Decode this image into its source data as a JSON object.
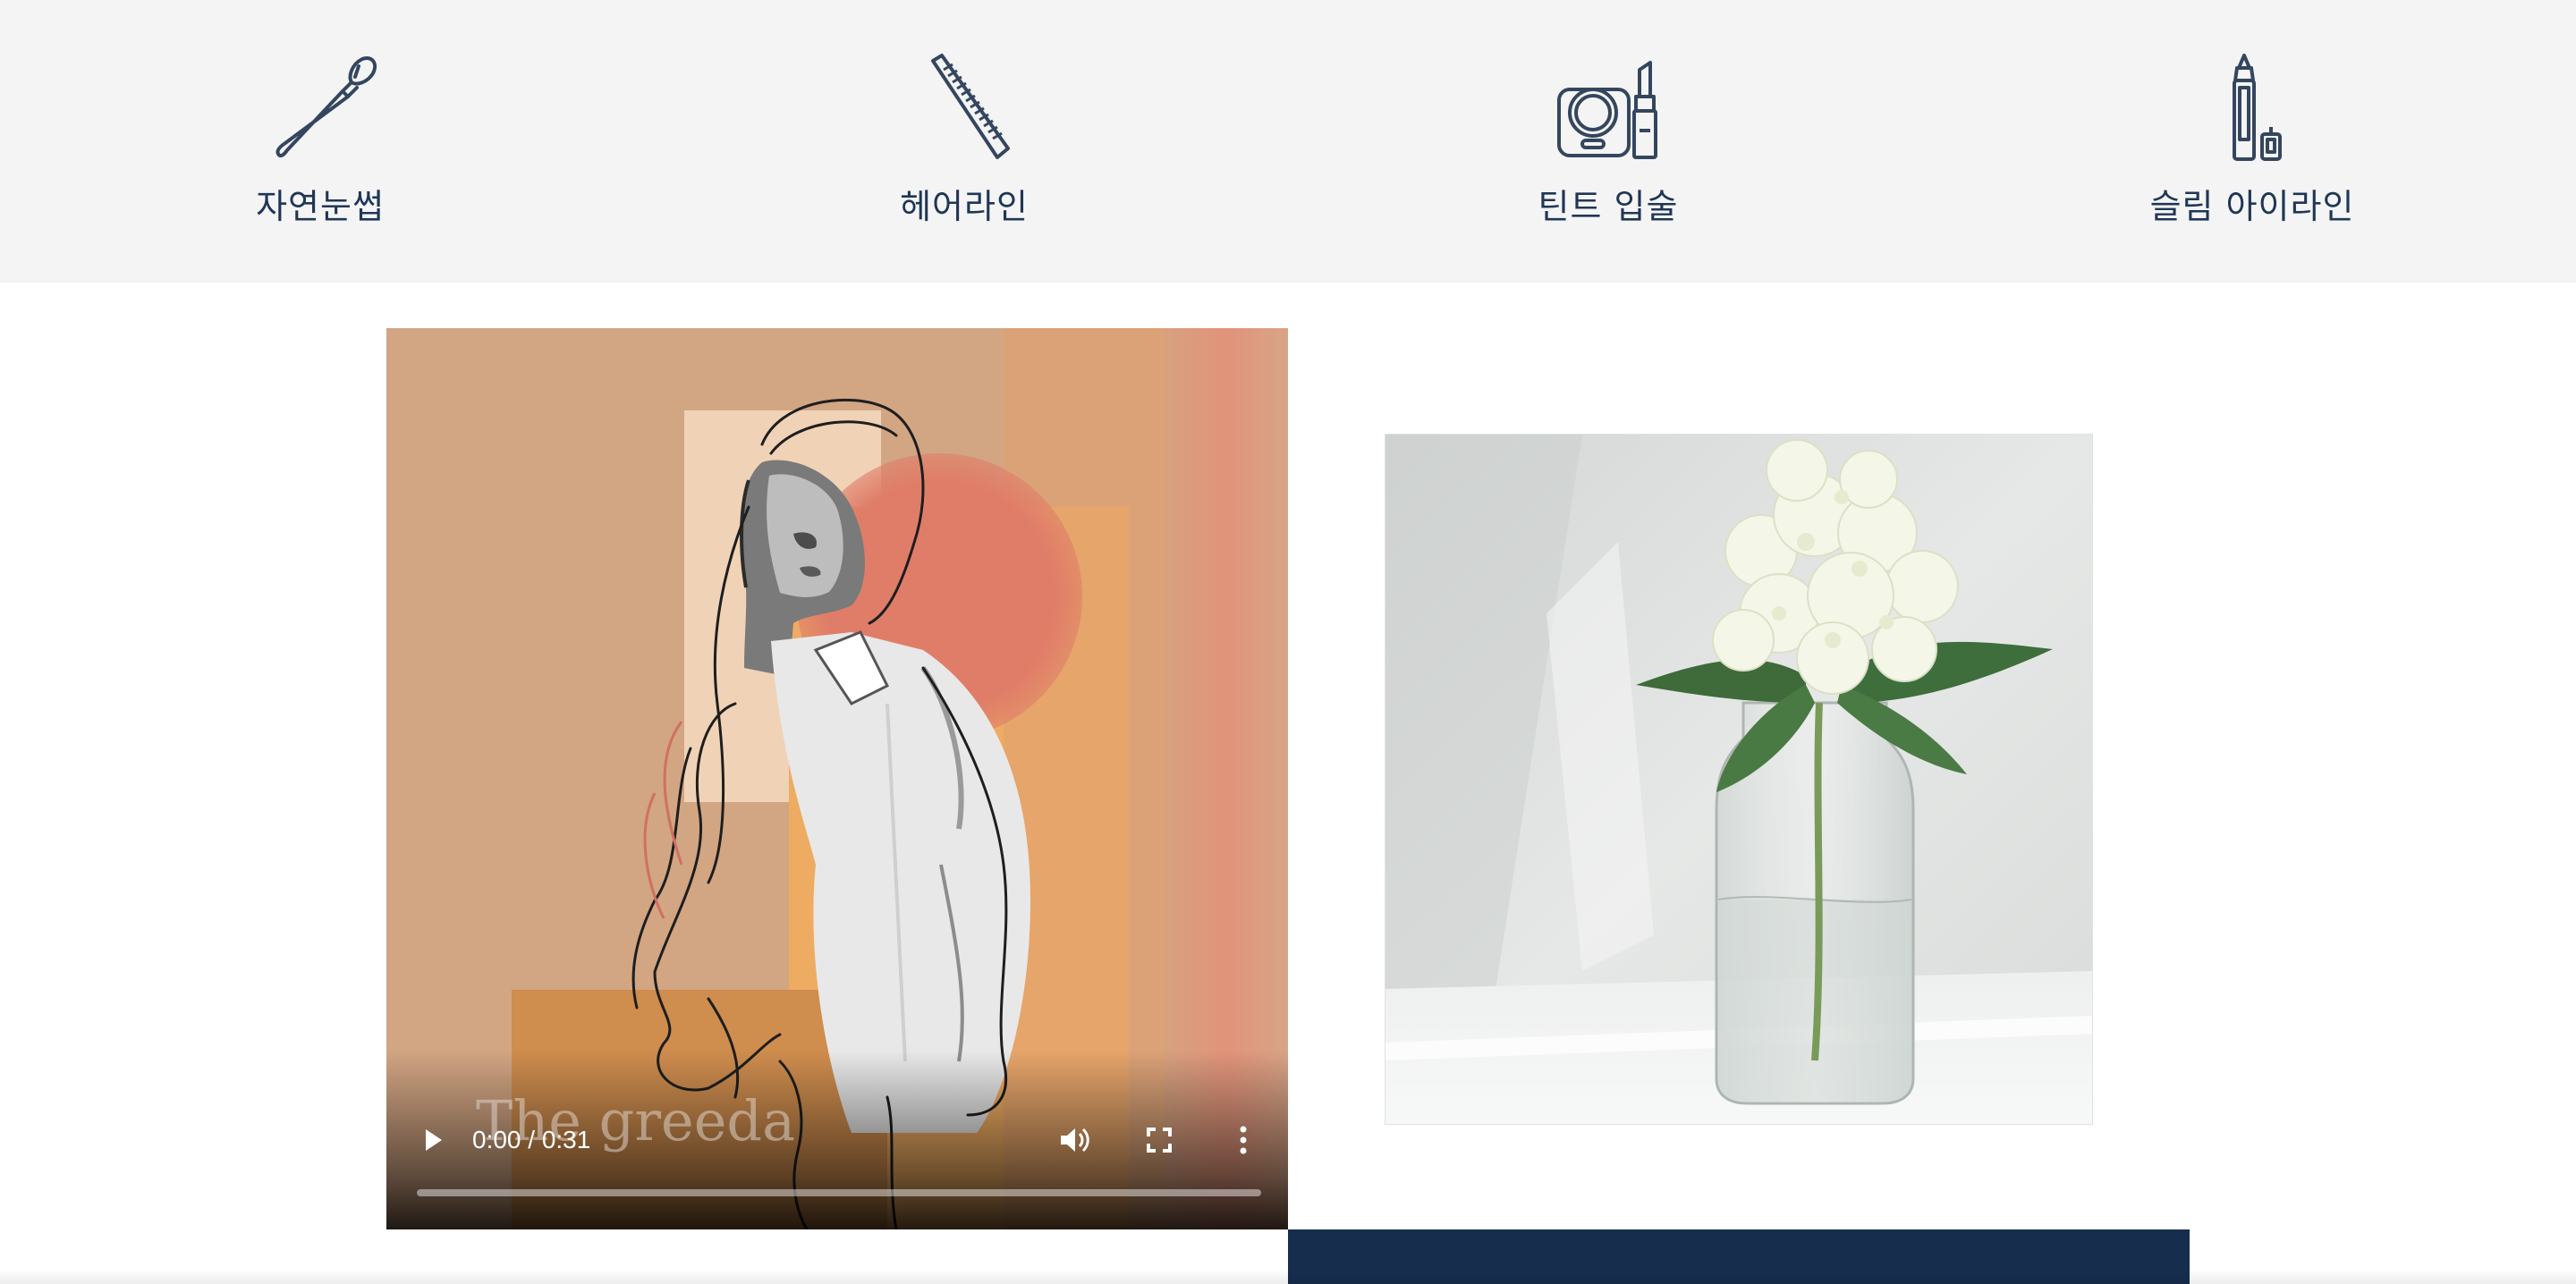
{
  "nav": {
    "items": [
      {
        "label": "자연눈썹",
        "icon": "makeup-brush-icon"
      },
      {
        "label": "헤어라인",
        "icon": "comb-icon"
      },
      {
        "label": "틴트 입술",
        "icon": "compact-lipstick-icon"
      },
      {
        "label": "슬림 아이라인",
        "icon": "eyeliner-pencil-icon"
      }
    ],
    "icon_color": "#34465f",
    "background": "#f4f4f4"
  },
  "video": {
    "watermark": "The greeda",
    "time": "0:00 / 0:31",
    "progress": 0,
    "controls": [
      "play-icon",
      "volume-icon",
      "fullscreen-icon",
      "more-options-icon"
    ]
  },
  "flower_image": {
    "subject": "white hydrangea in glass vase"
  },
  "colors": {
    "navy": "#172d4d",
    "peach": "#d2a583",
    "coral": "#e07d68",
    "orange": "#eeac62"
  }
}
